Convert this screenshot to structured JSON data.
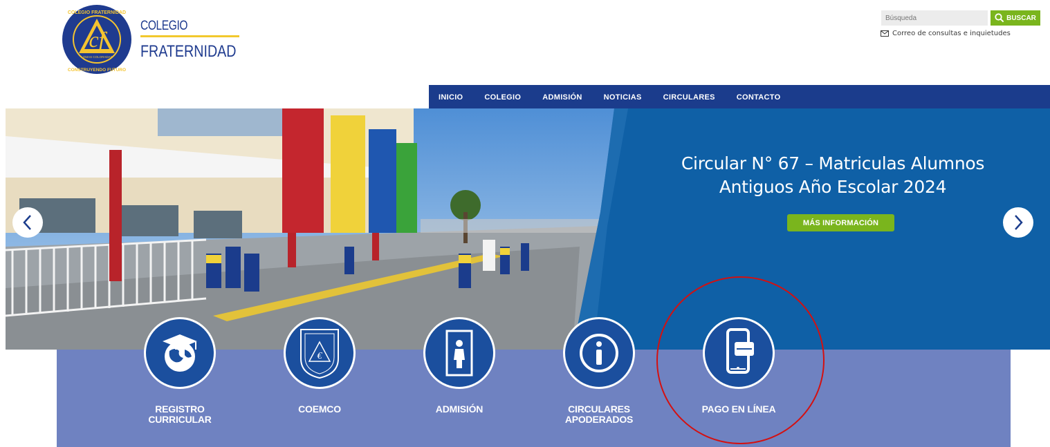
{
  "header": {
    "logo": {
      "alt": "Colegio Fraternidad logo",
      "ring_top": "COLEGIO FRATERNIDAD",
      "ring_bottom": "CONSTRUYENDO FUTURO",
      "monogram": "cf",
      "sub": "LOMAS COLORADAS"
    },
    "brand_line1": "COLEGIO",
    "brand_line2": "FRATERNIDAD",
    "search": {
      "placeholder": "Búsqueda",
      "button_label": "BUSCAR"
    },
    "contact_link": "Correo de consultas e inquietudes"
  },
  "nav": {
    "items": [
      "INICIO",
      "COLEGIO",
      "ADMISIÓN",
      "NOTICIAS",
      "CIRCULARES",
      "CONTACTO"
    ]
  },
  "hero": {
    "title_line1": "Circular N° 67 – Matriculas Alumnos",
    "title_line2": "Antiguos Año Escolar 2024",
    "button": "MÁS INFORMACIÓN"
  },
  "quick_links": [
    {
      "line1": "REGISTRO",
      "line2": "CURRICULAR",
      "icon": "graduation-globe-icon"
    },
    {
      "line1": "COEMCO",
      "line2": "",
      "icon": "coemco-shield-icon"
    },
    {
      "line1": "ADMISIÓN",
      "line2": "",
      "icon": "student-door-icon"
    },
    {
      "line1": "CIRCULARES",
      "line2": "APODERADOS",
      "icon": "info-icon"
    },
    {
      "line1": "PAGO EN LÍNEA",
      "line2": "",
      "icon": "mobile-payment-icon"
    }
  ],
  "colors": {
    "brand_blue": "#1b3c8c",
    "accent_green": "#7ab51d",
    "band_purple": "#6f82c1",
    "hero_blue": "#0f60a6",
    "annotation_red": "#d41010"
  }
}
